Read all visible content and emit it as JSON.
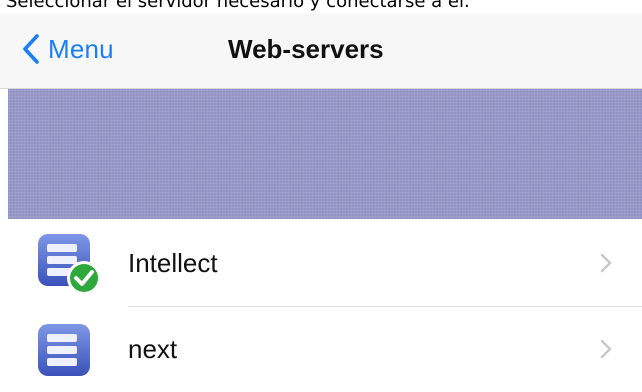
{
  "caption": "Seleccionar el servidor necesario y conectarse a él.",
  "navbar": {
    "back_label": "Menu",
    "title": "Web-servers"
  },
  "colors": {
    "accent": "#1a7ef6",
    "banner": "#9191c4",
    "server_icon": "#4b63c6",
    "check_badge": "#2ea83a"
  },
  "servers": [
    {
      "name": "Intellect",
      "icon": "server-connected-icon",
      "connected": true
    },
    {
      "name": "next",
      "icon": "server-icon",
      "connected": false
    }
  ]
}
